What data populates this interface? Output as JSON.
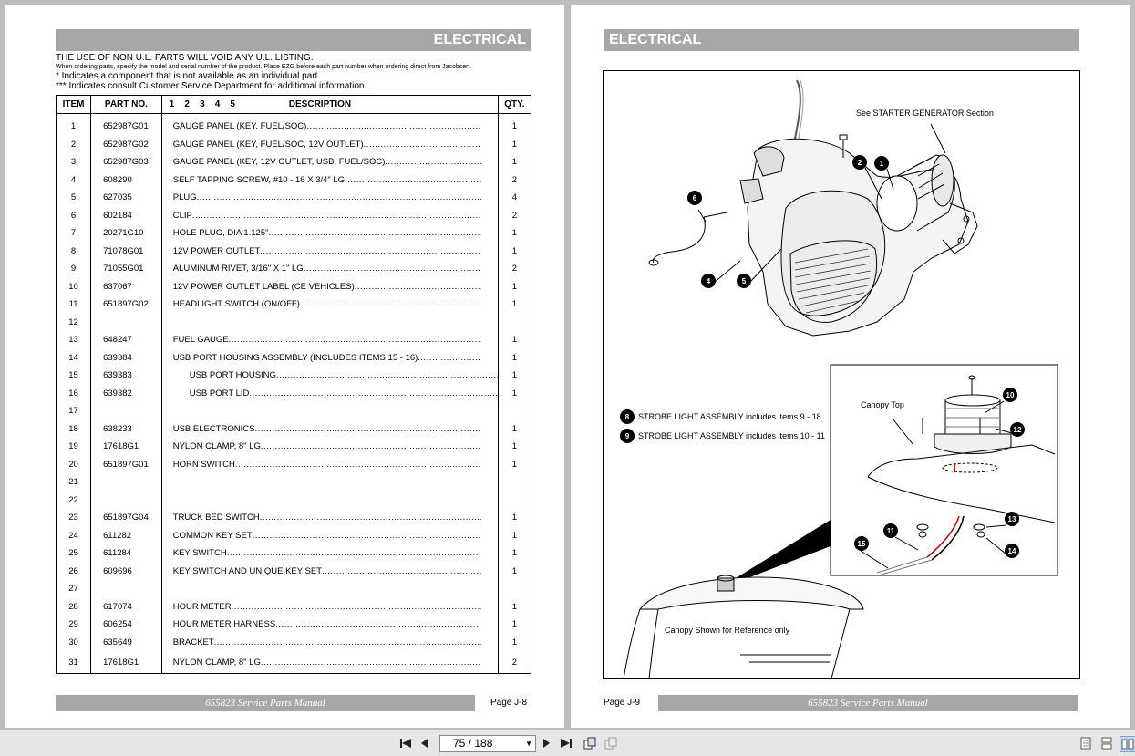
{
  "left_page": {
    "header": "ELECTRICAL",
    "notes": {
      "line1": "THE USE OF NON U.L. PARTS WILL VOID ANY U.L. LISTING.",
      "line2": "When ordering parts, specify the model and serial number of the product. Place EZG before each part number when ordering direct from Jacobsen.",
      "line3": "* Indicates a component that is not available as an individual part.",
      "line4": "*** Indicates consult Customer Service Department for additional information."
    },
    "table": {
      "headers": {
        "item": "ITEM",
        "part": "PART NO.",
        "levels": "1    2    3    4    5",
        "desc": "DESCRIPTION",
        "qty": "QTY."
      },
      "rows": [
        {
          "item": "1",
          "part": "652987G01",
          "desc": "GAUGE PANEL (KEY, FUEL/SOC)",
          "qty": "1",
          "indent": 0
        },
        {
          "item": "2",
          "part": "652987G02",
          "desc": "GAUGE PANEL (KEY, FUEL/SOC, 12V OUTLET)",
          "qty": "1",
          "indent": 0
        },
        {
          "item": "3",
          "part": "652987G03",
          "desc": "GAUGE PANEL (KEY, 12V OUTLET, USB, FUEL/SOC)",
          "qty": "1",
          "indent": 0
        },
        {
          "item": "4",
          "part": "608290",
          "desc": "SELF TAPPING SCREW, #10 - 16 X 3/4\" LG",
          "qty": "2",
          "indent": 0
        },
        {
          "item": "5",
          "part": "627035",
          "desc": "PLUG",
          "qty": "4",
          "indent": 0
        },
        {
          "item": "6",
          "part": "602184",
          "desc": "CLIP",
          "qty": "2",
          "indent": 0
        },
        {
          "item": "7",
          "part": "20271G10",
          "desc": "HOLE PLUG, DIA 1.125\"",
          "qty": "1",
          "indent": 0
        },
        {
          "item": "8",
          "part": "71078G01",
          "desc": "12V POWER OUTLET",
          "qty": "1",
          "indent": 0
        },
        {
          "item": "9",
          "part": "71055G01",
          "desc": "ALUMINUM RIVET, 3/16\" X 1\" LG",
          "qty": "2",
          "indent": 0
        },
        {
          "item": "10",
          "part": "637067",
          "desc": "12V POWER OUTLET LABEL (CE VEHICLES)",
          "qty": "1",
          "indent": 0
        },
        {
          "item": "11",
          "part": "651897G02",
          "desc": "HEADLIGHT SWITCH (ON/OFF)",
          "qty": "1",
          "indent": 0
        },
        {
          "item": "12",
          "part": "",
          "desc": "",
          "qty": "",
          "indent": 0
        },
        {
          "item": "13",
          "part": "648247",
          "desc": "FUEL GAUGE",
          "qty": "1",
          "indent": 0
        },
        {
          "item": "14",
          "part": "639384",
          "desc": "USB PORT HOUSING ASSEMBLY (INCLUDES ITEMS 15 - 16)",
          "qty": "1",
          "indent": 0
        },
        {
          "item": "15",
          "part": "639383",
          "desc": "USB PORT HOUSING",
          "qty": "1",
          "indent": 1
        },
        {
          "item": "16",
          "part": "639382",
          "desc": "USB PORT LID",
          "qty": "1",
          "indent": 1
        },
        {
          "item": "17",
          "part": "",
          "desc": "",
          "qty": "",
          "indent": 0
        },
        {
          "item": "18",
          "part": "638233",
          "desc": "USB ELECTRONICS",
          "qty": "1",
          "indent": 0
        },
        {
          "item": "19",
          "part": "17618G1",
          "desc": "NYLON CLAMP, 8\" LG",
          "qty": "1",
          "indent": 0
        },
        {
          "item": "20",
          "part": "651897G01",
          "desc": "HORN SWITCH",
          "qty": "1",
          "indent": 0
        },
        {
          "item": "21",
          "part": "",
          "desc": "",
          "qty": "",
          "indent": 0
        },
        {
          "item": "22",
          "part": "",
          "desc": "",
          "qty": "",
          "indent": 0
        },
        {
          "item": "23",
          "part": "651897G04",
          "desc": "TRUCK BED SWITCH",
          "qty": "1",
          "indent": 0
        },
        {
          "item": "24",
          "part": "611282",
          "desc": "COMMON KEY SET",
          "qty": "1",
          "indent": 0
        },
        {
          "item": "25",
          "part": "611284",
          "desc": "KEY SWITCH",
          "qty": "1",
          "indent": 0
        },
        {
          "item": "26",
          "part": "609696",
          "desc": "KEY SWITCH AND UNIQUE KEY SET",
          "qty": "1",
          "indent": 0
        },
        {
          "item": "27",
          "part": "",
          "desc": "",
          "qty": "",
          "indent": 0
        },
        {
          "item": "28",
          "part": "617074",
          "desc": "HOUR METER",
          "qty": "1",
          "indent": 0
        },
        {
          "item": "29",
          "part": "606254",
          "desc": "HOUR METER HARNESS",
          "qty": "1",
          "indent": 0
        },
        {
          "item": "30",
          "part": "635649",
          "desc": "BRACKET",
          "qty": "1",
          "indent": 0
        },
        {
          "item": "31",
          "part": "17618G1",
          "desc": "NYLON CLAMP, 8\" LG",
          "qty": "2",
          "indent": 0
        }
      ]
    },
    "footer": "655823 Service Parts Manual",
    "page_number": "Page  J-8"
  },
  "right_page": {
    "header": "ELECTRICAL",
    "diagram": {
      "label_starter": "See STARTER GENERATOR Section",
      "label_canopy_top": "Canopy Top",
      "label_canopy_ref": "Canopy Shown for Reference only",
      "strobe8_num": "8",
      "strobe8_text": "STROBE LIGHT ASSEMBLY includes items 9 - 18",
      "strobe9_num": "9",
      "strobe9_text": "STROBE LIGHT ASSEMBLY includes items 10 - 11",
      "callouts": [
        "1",
        "2",
        "4",
        "5",
        "6",
        "10",
        "11",
        "12",
        "13",
        "14",
        "15"
      ]
    },
    "footer": "655823 Service Parts Manual",
    "page_number": "Page  J-9"
  },
  "toolbar": {
    "first_icon": "first-page-icon",
    "prev_icon": "previous-page-icon",
    "page_indicator": "75 / 188",
    "next_icon": "next-page-icon",
    "last_icon": "last-page-icon"
  }
}
